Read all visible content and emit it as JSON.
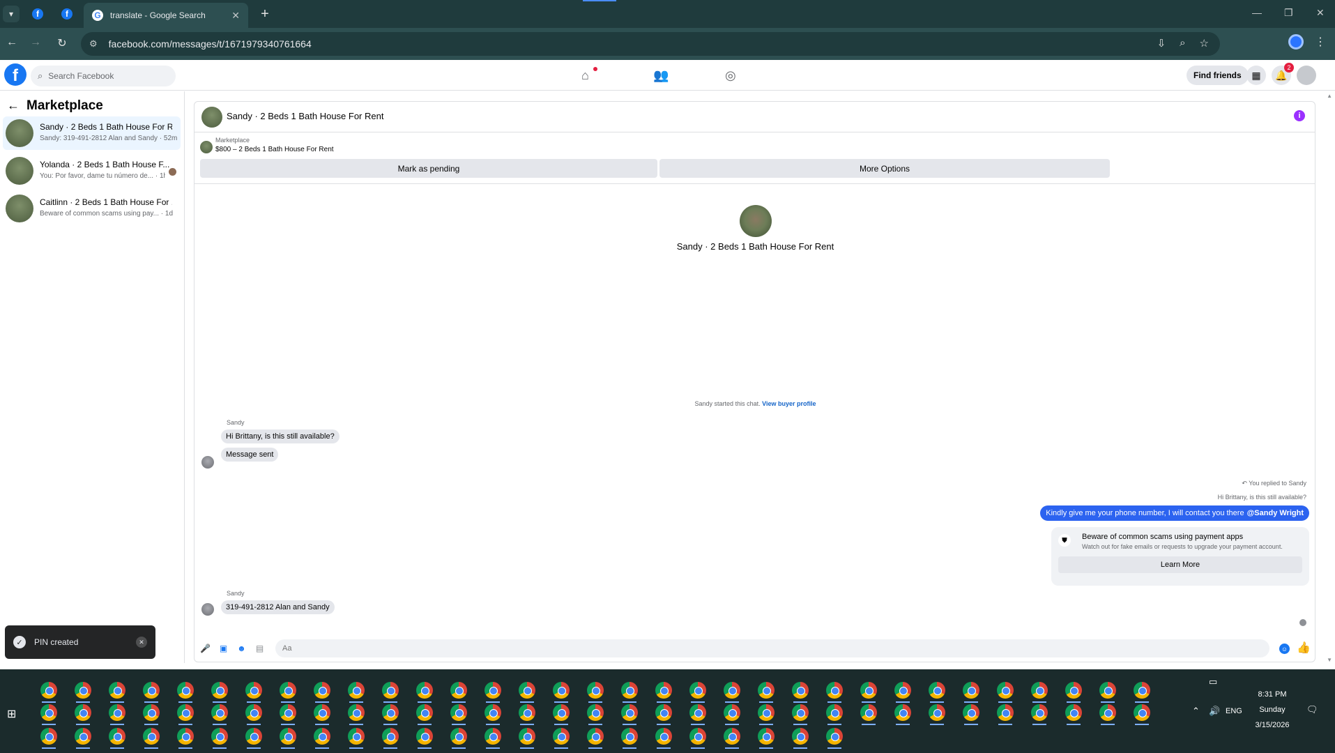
{
  "browser": {
    "tabs": [
      {
        "title": "",
        "icon": "facebook-icon"
      },
      {
        "title": "",
        "icon": "facebook-icon"
      },
      {
        "title": "translate - Google Search",
        "icon": "google-icon",
        "active": true
      }
    ],
    "url": "facebook.com/messages/t/1671979340761664"
  },
  "fb": {
    "logo": "f",
    "search_placeholder": "Search Facebook",
    "find_friends": "Find friends",
    "notification_count": "2"
  },
  "sidebar": {
    "title": "Marketplace",
    "conversations": [
      {
        "name": "Sandy · 2 Beds 1 Bath House For R...",
        "preview": "Sandy: 319-491-2812 Alan and Sandy · 52m",
        "active": true
      },
      {
        "name": "Yolanda · 2 Beds 1 Bath House F...",
        "preview": "You: Por favor, dame tu número de... · 1h"
      },
      {
        "name": "Caitlinn · 2 Beds 1 Bath House For ...",
        "preview": "Beware of common scams using pay... · 1d"
      }
    ]
  },
  "toast": {
    "text": "PIN created"
  },
  "chat": {
    "header_title": "Sandy · 2 Beds 1 Bath House For Rent",
    "listing_category": "Marketplace",
    "listing_price": "$800 – 2 Beds 1 Bath House For Rent",
    "mark_pending": "Mark as pending",
    "more_options": "More Options",
    "hero_title": "Sandy · 2 Beds 1 Bath House For Rent",
    "started_text": "Sandy started this chat.",
    "view_profile": "View buyer profile",
    "messages": [
      {
        "sender": "Sandy",
        "text": "Hi Brittany, is this still available?"
      },
      {
        "text": "Message sent"
      },
      {
        "sender": "Sandy",
        "text": "319-491-2812 Alan and Sandy"
      }
    ],
    "reply_label": "You replied to Sandy",
    "reply_quote": "Hi Brittany, is this still available?",
    "my_message": "Kindly give me your phone number, I will contact you there",
    "my_mention": "@Sandy Wright",
    "scam_title": "Beware of common scams using payment apps",
    "scam_subtitle": "Watch out for fake emails or requests to upgrade your payment account.",
    "learn_more": "Learn More",
    "composer_placeholder": "Aa"
  },
  "taskbar": {
    "time": "8:31 PM",
    "day": "Sunday",
    "date": "3/15/2026",
    "lang": "ENG"
  },
  "colors": {
    "fb_blue": "#1877f2",
    "my_bubble": "#2c63f0",
    "browser_dark": "#1f3b3d",
    "taskbar": "#1b2b2c"
  }
}
